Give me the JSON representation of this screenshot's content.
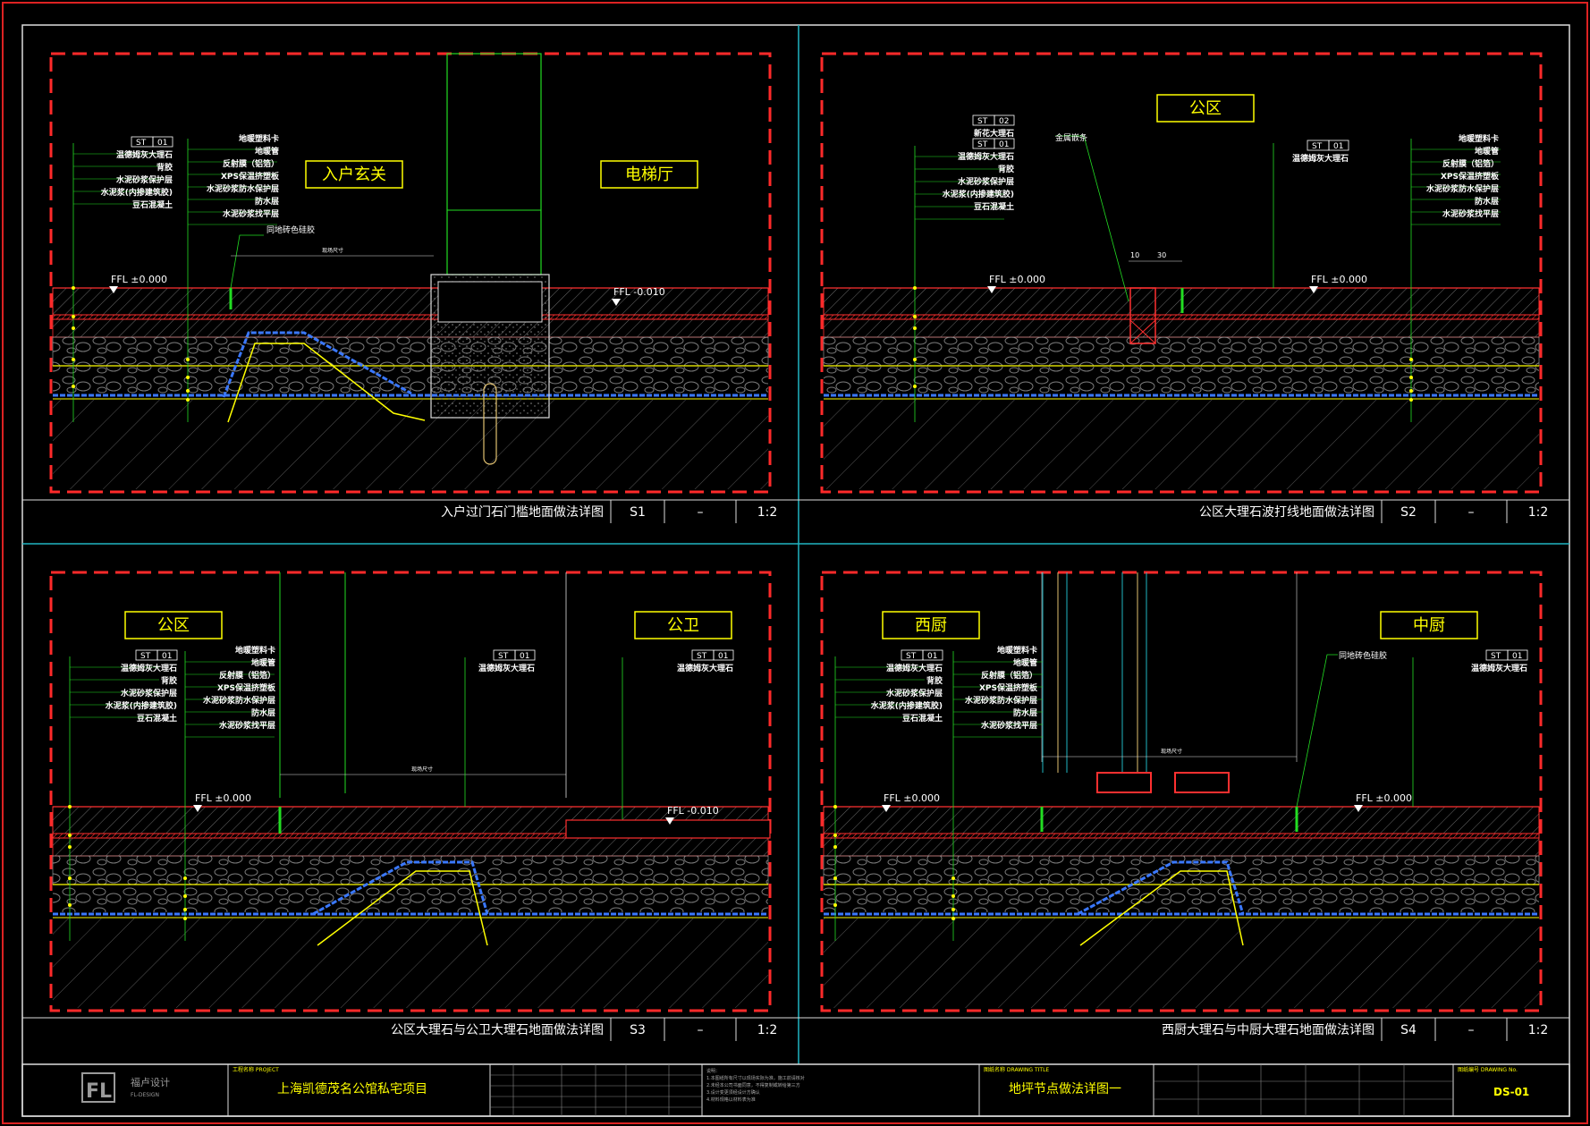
{
  "panels": [
    {
      "id": "S1",
      "title": "入户过门石门槛地面做法详图",
      "code": "S1",
      "dash": "–",
      "scale": "1:2",
      "room_labels": [
        "入户玄关",
        "电梯厅"
      ],
      "ffl_left": "FFL ±0.000",
      "ffl_right": "FFL -0.010",
      "note_gap": "同地砖色硅胶",
      "dim_note": "现场尺寸",
      "callout_left": {
        "tag": [
          "ST",
          "01"
        ],
        "lines": [
          "温德姆灰大理石",
          "背胶",
          "水泥砂浆保护层",
          "水泥浆(内掺建筑胶)",
          "豆石混凝土"
        ]
      },
      "callout_right": {
        "lines": [
          "地暖塑料卡",
          "地暖管",
          "反射膜（铝箔）",
          "XPS保温挤塑板",
          "水泥砂浆防水保护层",
          "防水层",
          "水泥砂浆找平层"
        ]
      }
    },
    {
      "id": "S2",
      "title": "公区大理石波打线地面做法详图",
      "code": "S2",
      "dash": "–",
      "scale": "1:2",
      "room_labels": [
        "公区"
      ],
      "ffl_left": "FFL ±0.000",
      "ffl_right": "FFL ±0.000",
      "note_gap": "金属嵌条",
      "dims": [
        "10",
        "30"
      ],
      "callout_left": {
        "tag": [
          "ST",
          "02"
        ],
        "tag2": [
          "ST",
          "01"
        ],
        "lines": [
          "新花大理石",
          "温德姆灰大理石",
          "背胶",
          "水泥砂浆保护层",
          "水泥浆(内掺建筑胶)",
          "豆石混凝土"
        ]
      },
      "callout_mid": {
        "tag": [
          "ST",
          "01"
        ],
        "lines": [
          "温德姆灰大理石"
        ]
      },
      "callout_right": {
        "lines": [
          "地暖塑料卡",
          "地暖管",
          "反射膜（铝箔）",
          "XPS保温挤塑板",
          "水泥砂浆防水保护层",
          "防水层",
          "水泥砂浆找平层"
        ]
      }
    },
    {
      "id": "S3",
      "title": "公区大理石与公卫大理石地面做法详图",
      "code": "S3",
      "dash": "–",
      "scale": "1:2",
      "room_labels": [
        "公区",
        "公卫"
      ],
      "ffl_left": "FFL ±0.000",
      "ffl_right": "FFL -0.010",
      "dim_note": "现场尺寸",
      "callout_left": {
        "tag": [
          "ST",
          "01"
        ],
        "lines": [
          "温德姆灰大理石",
          "背胶",
          "水泥砂浆保护层",
          "水泥浆(内掺建筑胶)",
          "豆石混凝土"
        ]
      },
      "callout_mid": {
        "tag": [
          "ST",
          "01"
        ],
        "lines": [
          "温德姆灰大理石"
        ]
      },
      "callout_right": {
        "tag": [
          "ST",
          "01"
        ],
        "lines": [
          "温德姆灰大理石"
        ]
      },
      "callout_right2": {
        "lines": [
          "地暖塑料卡",
          "地暖管",
          "反射膜（铝箔）",
          "XPS保温挤塑板",
          "水泥砂浆防水保护层",
          "防水层",
          "水泥砂浆找平层"
        ]
      }
    },
    {
      "id": "S4",
      "title": "西厨大理石与中厨大理石地面做法详图",
      "code": "S4",
      "dash": "–",
      "scale": "1:2",
      "room_labels": [
        "西厨",
        "中厨"
      ],
      "ffl_left": "FFL ±0.000",
      "ffl_right": "FFL ±0.000",
      "note_gap": "同地砖色硅胶",
      "dim_note": "现场尺寸",
      "callout_left": {
        "tag": [
          "ST",
          "01"
        ],
        "lines": [
          "温德姆灰大理石",
          "背胶",
          "水泥砂浆保护层",
          "水泥浆(内掺建筑胶)",
          "豆石混凝土"
        ]
      },
      "callout_right": {
        "tag": [
          "ST",
          "01"
        ],
        "lines": [
          "温德姆灰大理石"
        ]
      },
      "callout_mid": {
        "lines": [
          "地暖塑料卡",
          "地暖管",
          "反射膜（铝箔）",
          "XPS保温挤塑板",
          "水泥砂浆防水保护层",
          "防水层",
          "水泥砂浆找平层"
        ]
      }
    }
  ],
  "title_block": {
    "logo_text": "FL",
    "company": "福卢设计",
    "company_en": "FL-DESIGN",
    "project_label": "工程名称  PROJECT",
    "project": "上海凯德茂名公馆私宅项目",
    "drawing_label": "图纸名称  DRAWING TITLE",
    "drawing_title": "地坪节点做法详图一",
    "number_label": "图纸编号  DRAWING No.",
    "drawing_no": "DS-01"
  },
  "colors": {
    "background": "#000000",
    "frame_red": "#ff2a2a",
    "divider_cyan": "#21b6c2",
    "label_yellow": "#ffff00",
    "text_white": "#ffffff",
    "leader_green": "#22dd22"
  }
}
